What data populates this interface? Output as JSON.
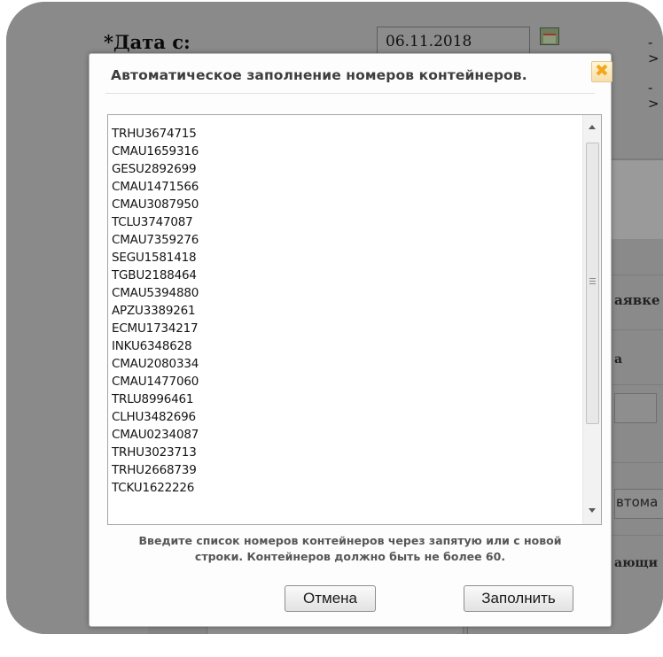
{
  "background": {
    "date_label": "*Дата с:",
    "date_value": "06.11.2018",
    "arrow": "->",
    "fragment_1": "аявке",
    "fragment_2": "а",
    "fragment_3": "втома",
    "fragment_4": "ающи"
  },
  "dialog": {
    "title": "Автоматическое заполнение номеров контейнеров.",
    "close_symbol": "✖",
    "containers_text": "TRHU3674715\nCMAU1659316\nGESU2892699\nCMAU1471566\nCMAU3087950\nTCLU3747087\nCMAU7359276\nSEGU1581418\nTGBU2188464\nCMAU5394880\nAPZU3389261\nECMU1734217\nINKU6348628\nCMAU2080334\nCMAU1477060\nTRLU8996461\nCLHU3482696\nCMAU0234087\nTRHU3023713\nTRHU2668739\nTCKU1622226",
    "hint_line1": "Введите список номеров контейнеров через запятую или с новой",
    "hint_line2": "строки. Контейнеров должно быть не более 60.",
    "cancel_label": "Отмена",
    "fill_label": "Заполнить"
  }
}
